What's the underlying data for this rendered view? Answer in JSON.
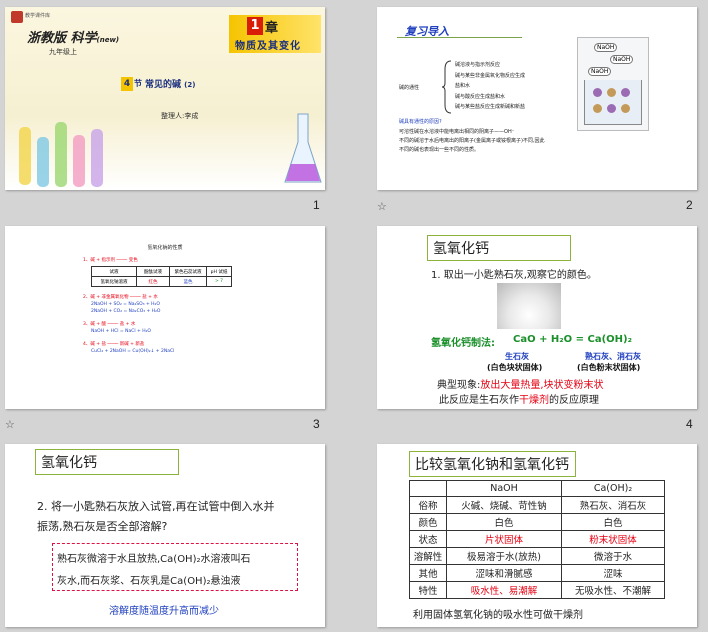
{
  "slides": [
    {
      "number": "1",
      "title_main": "浙教版 科学",
      "title_sub": "(new)",
      "grade": "九年级上",
      "chapter_num": "1",
      "chapter_word": "章",
      "chapter_title": "物质及其变化",
      "section_num": "4",
      "section_word": "节",
      "section_title": "常见的碱",
      "section_part": "(2)",
      "compiler": "整理人:",
      "compiler_name": "李成",
      "logo_text": "教学课件库"
    },
    {
      "number": "2",
      "heading": "复习导入",
      "center_label": "碱的通性",
      "branches": [
        "碱溶液与指示剂反应",
        "碱与某些非金属氧化物反应生成",
        "盐和水",
        "碱与酸反应生成盐和水",
        "碱与某些盐反应生成新碱和新盐"
      ],
      "question": "碱具有通性的原因?",
      "answer_lines": [
        "可溶性碱在水溶液中能电离出相同的阴离子——OH⁻",
        "不同的碱溶于水后电离出的阳离子(金属离子或铵根离子)不同,因此",
        "不同的碱也表现出一些不同的性质。"
      ],
      "beaker_labels": [
        "NaOH",
        "NaOH",
        "NaOH"
      ]
    },
    {
      "number": "3",
      "title": "氢氧化钠的性质",
      "item1": "1、碱 + 指示剂 ──── 变色",
      "table_header": [
        "试液",
        "酚酞试液",
        "紫色石蕊试液",
        "pH 试纸"
      ],
      "table_row": [
        "氢氧化钠溶液",
        "红色",
        "蓝色",
        "> 7"
      ],
      "item2": "2、碱 + 非金属氧化物 ──── 盐 + 水",
      "eq2": [
        "2NaOH + SO₂ = Na₂SO₃ + H₂O",
        "2NaOH + CO₂ = Na₂CO₃ + H₂O"
      ],
      "item3": "3、碱 + 酸 ──── 盐 + 水",
      "eq3": "NaOH + HCl = NaCl + H₂O",
      "item4": "4、碱 + 盐 ──── 新碱 + 新盐",
      "eq4": "CuCl₂ + 2NaOH = Cu(OH)₂↓ + 2NaCl"
    },
    {
      "number": "4",
      "heading": "氢氧化钙",
      "step": "1. 取出一小匙熟石灰,观察它的颜色。",
      "method_label": "氢氧化钙制法:",
      "equation": "CaO + H₂O = Ca(OH)₂",
      "left_name": "生石灰",
      "left_desc": "(白色块状固体)",
      "right_name": "熟石灰、消石灰",
      "right_desc": "(白色粉末状固体)",
      "phenomenon_label": "典型现象:",
      "phenomenon_red": "放出大量热量,块状变粉末状",
      "principle_prefix": "此反应是生石灰作",
      "principle_red": "干燥剂",
      "principle_suffix": "的反应原理"
    },
    {
      "number": "5",
      "heading": "氢氧化钙",
      "question_l1": "2. 将一小匙熟石灰放入试管,再在试管中倒入水并",
      "question_l2": "振荡,熟石灰是否全部溶解?",
      "answer_l1": "熟石灰微溶于水且放热,Ca(OH)₂水溶液叫石",
      "answer_l2": "灰水,而石灰浆、石灰乳是Ca(OH)₂悬浊液",
      "note": "溶解度随温度升高而减少"
    },
    {
      "number": "6",
      "heading": "比较氢氧化钠和氢氧化钙",
      "col_headers": [
        "",
        "NaOH",
        "Ca(OH)₂"
      ],
      "rows": [
        {
          "label": "俗称",
          "naoh": "火碱、烧碱、苛性钠",
          "caoh": "熟石灰、消石灰"
        },
        {
          "label": "颜色",
          "naoh": "白色",
          "caoh": "白色"
        },
        {
          "label": "状态",
          "naoh": "片状固体",
          "caoh": "粉末状固体"
        },
        {
          "label": "溶解性",
          "naoh": "极易溶于水(放热)",
          "caoh": "微溶于水"
        },
        {
          "label": "其他",
          "naoh": "涩味和滑腻感",
          "caoh": "涩味"
        },
        {
          "label": "特性",
          "naoh": "吸水性、易潮解",
          "caoh": "无吸水性、不潮解"
        }
      ],
      "footer": "利用固体氢氧化钠的吸水性可做干燥剂"
    }
  ],
  "star_icon": "☆",
  "colors": {
    "red": "#e60012",
    "blue": "#1f3fbf",
    "green": "#1a8f2a",
    "border_green": "#8cb33c",
    "navy": "#1a2f80"
  }
}
